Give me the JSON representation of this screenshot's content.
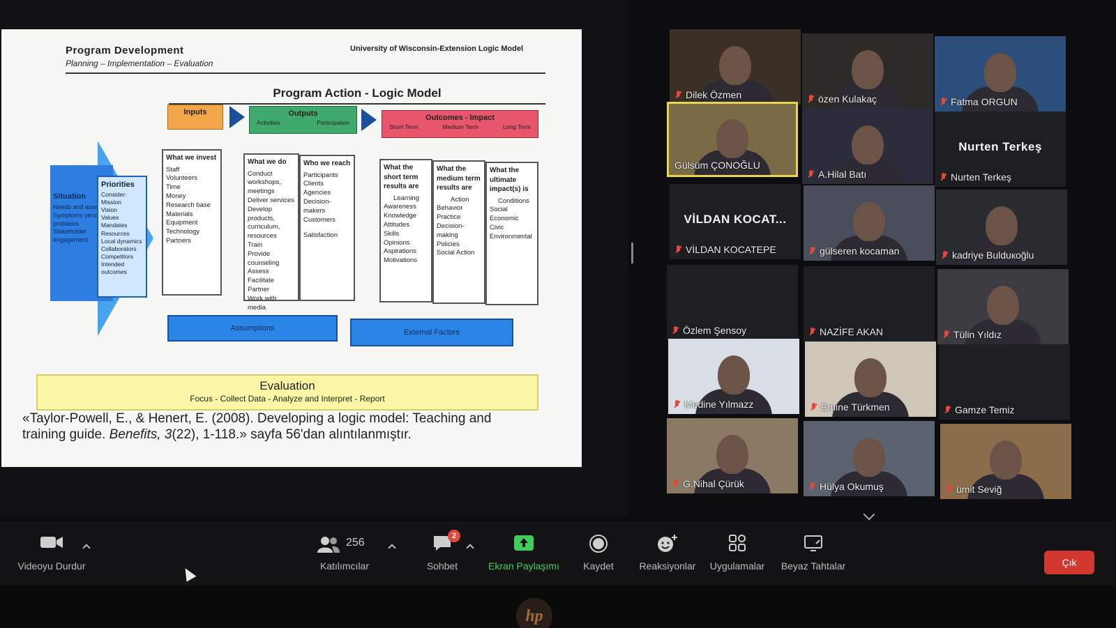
{
  "slide": {
    "header_title": "Program Development",
    "header_subtitle": "Planning – Implementation – Evaluation",
    "source_title": "University of Wisconsin-Extension Logic Model",
    "main_title": "Program Action - Logic Model",
    "inputs_label": "Inputs",
    "outputs_label": "Outputs",
    "outputs_sub": [
      "Activities",
      "Participation"
    ],
    "outcomes_label": "Outcomes - Impact",
    "outcomes_sub": [
      "Short Term",
      "Medium Term",
      "Long Term"
    ],
    "situation": {
      "title": "Situation",
      "items": [
        "Needs and assets",
        "Symptoms versus problems",
        "Stakeholder engagement"
      ]
    },
    "priorities": {
      "title": "Priorities",
      "items": [
        "Consider:",
        "Mission",
        "Vision",
        "Values",
        "Mandates",
        "Resources",
        "Local dynamics",
        "Collaborators",
        "Competitors",
        "Intended outcomes"
      ]
    },
    "invest": {
      "title": "What we invest",
      "items": [
        "Staff",
        "Volunteers",
        "Time",
        "Money",
        "Research base",
        "Materials",
        "Equipment",
        "Technology",
        "Partners"
      ]
    },
    "what_we_do": {
      "title": "What we do",
      "items": [
        "Conduct workshops, meetings",
        "Deliver services",
        "Develop products, curriculum, resources",
        "Train",
        "Provide counseling",
        "Assess",
        "Facilitate",
        "Partner",
        "Work with media"
      ]
    },
    "who_we_reach": {
      "title": "Who we reach",
      "items": [
        "Participants",
        "Clients",
        "Agencies",
        "Decision-makers",
        "Customers",
        "Satisfaction"
      ]
    },
    "short_term": {
      "title": "What the short term results are",
      "items": [
        "Learning",
        "Awareness",
        "Knowledge",
        "Attitudes",
        "Skills",
        "Opinions",
        "Aspirations",
        "Motivations"
      ]
    },
    "medium_term": {
      "title": "What the medium term results are",
      "items": [
        "Action",
        "Behavior",
        "Practice",
        "Decision-making",
        "Policies",
        "Social Action"
      ]
    },
    "long_term": {
      "title": "What the ultimate impact(s) is",
      "items": [
        "Conditions",
        "Social",
        "Economic",
        "Civic",
        "Environmental"
      ]
    },
    "assumptions": "Assumptions",
    "external_factors": "External Factors",
    "evaluation_title": "Evaluation",
    "evaluation_sub": "Focus - Collect Data - Analyze and Interpret - Report",
    "citation_line1_prefix": "«Taylor-Powell, E., & Henert, E. (2008). Developing a logic model: Teaching and",
    "citation_line2_prefix": "training guide. ",
    "citation_journal": "Benefits, 3",
    "citation_line2_suffix": "(22), 1-118.» sayfa 56'dan alıntılanmıştır."
  },
  "participants": [
    {
      "name": "Dilek Özmen",
      "video": true
    },
    {
      "name": "özen Kulakaç",
      "video": true
    },
    {
      "name": "Fatma ORGUN",
      "video": true
    },
    {
      "name": "Gülsüm ÇONOĞLU",
      "video": true,
      "active": true
    },
    {
      "name": "A.Hilal Batı",
      "video": true
    },
    {
      "name": "Nurten Terkeş",
      "video": false,
      "display": "Nurten Terkeş"
    },
    {
      "name": "VİLDAN KOCATEPE",
      "video": false,
      "display": "VİLDAN KOCAT..."
    },
    {
      "name": "gülseren kocaman",
      "video": true
    },
    {
      "name": "kadriye Bulduкoğlu",
      "video": true
    },
    {
      "name": "Özlem Şensoy",
      "video": false
    },
    {
      "name": "NAZİFE AKAN",
      "video": false
    },
    {
      "name": "Tülin Yıldız",
      "video": true
    },
    {
      "name": "Medine Yılmazz",
      "video": true
    },
    {
      "name": "Emine Türkmen",
      "video": true
    },
    {
      "name": "Gamze Temiz",
      "video": false
    },
    {
      "name": "G.Nihal Çürük",
      "video": true
    },
    {
      "name": "Hülya Okumuş",
      "video": true
    },
    {
      "name": "ümit Seviğ",
      "video": true
    }
  ],
  "toolbar": {
    "video": "Videoyu Durdur",
    "participants": "Katılımcılar",
    "participants_count": "256",
    "chat": "Sohbet",
    "chat_badge": "2",
    "share": "Ekran Paylaşımı",
    "record": "Kaydet",
    "reactions": "Reaksiyonlar",
    "apps": "Uygulamalar",
    "whiteboards": "Beyaz Tahtalar",
    "leave": "Çık"
  },
  "colors": {
    "share_green": "#3fce5c",
    "leave_red": "#d2382f",
    "active_border": "#e8d44d",
    "muted_red": "#e5483b"
  },
  "device_logo": "hp"
}
